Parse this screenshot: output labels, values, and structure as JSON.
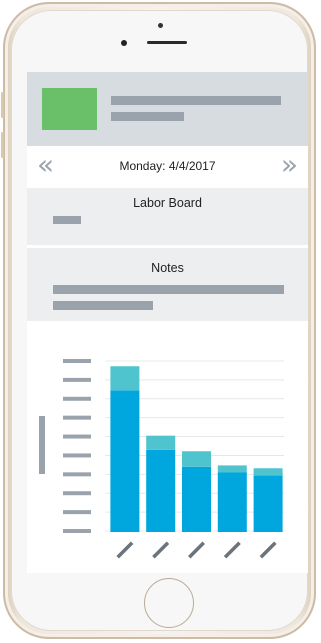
{
  "date_nav": {
    "prev_icon": "double-chevron-left-icon",
    "next_icon": "double-chevron-right-icon",
    "prev_glyph": "«",
    "next_glyph": "»",
    "date_label": "Monday: 4/4/2017"
  },
  "labor_board": {
    "title": "Labor Board"
  },
  "notes": {
    "title": "Notes"
  },
  "colors": {
    "avatar": "#6abf69",
    "bar_primary": "#00a6de",
    "bar_secondary": "#4fc4cf",
    "placeholder": "#9aa3ab",
    "header_bg": "#d7dce1",
    "section_bg": "#eceef0"
  },
  "chart_data": {
    "type": "bar",
    "stacked": true,
    "categories": [
      "",
      "",
      "",
      "",
      ""
    ],
    "series": [
      {
        "values": [
          100,
          58,
          46,
          42,
          40
        ]
      },
      {
        "values": [
          17,
          10,
          11,
          5,
          5
        ]
      }
    ],
    "ylim": [
      0,
      120
    ],
    "grid": true,
    "tick_labels_shown_as_placeholders": true
  }
}
